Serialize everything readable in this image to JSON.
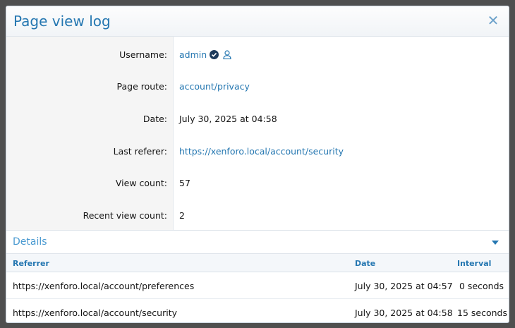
{
  "overlay": {
    "title": "Page view log",
    "close_label": "✕"
  },
  "fields": {
    "username": {
      "label": "Username:",
      "value": "admin"
    },
    "route": {
      "label": "Page route:",
      "value": "account/privacy"
    },
    "date": {
      "label": "Date:",
      "value": "July 30, 2025 at 04:58"
    },
    "referer": {
      "label": "Last referer:",
      "value": "https://xenforo.local/account/security"
    },
    "view_count": {
      "label": "View count:",
      "value": "57"
    },
    "recent_view_count": {
      "label": "Recent view count:",
      "value": "2"
    }
  },
  "details": {
    "title": "Details",
    "columns": {
      "referrer": "Referrer",
      "date": "Date",
      "interval": "Interval"
    },
    "rows": [
      {
        "referrer": "https://xenforo.local/account/preferences",
        "date": "July 30, 2025 at 04:57",
        "interval": "0 seconds"
      },
      {
        "referrer": "https://xenforo.local/account/security",
        "date": "July 30, 2025 at 04:58",
        "interval": "15 seconds"
      }
    ]
  },
  "colors": {
    "accent": "#2577b1",
    "verified_badge": "#1d3a5c"
  }
}
